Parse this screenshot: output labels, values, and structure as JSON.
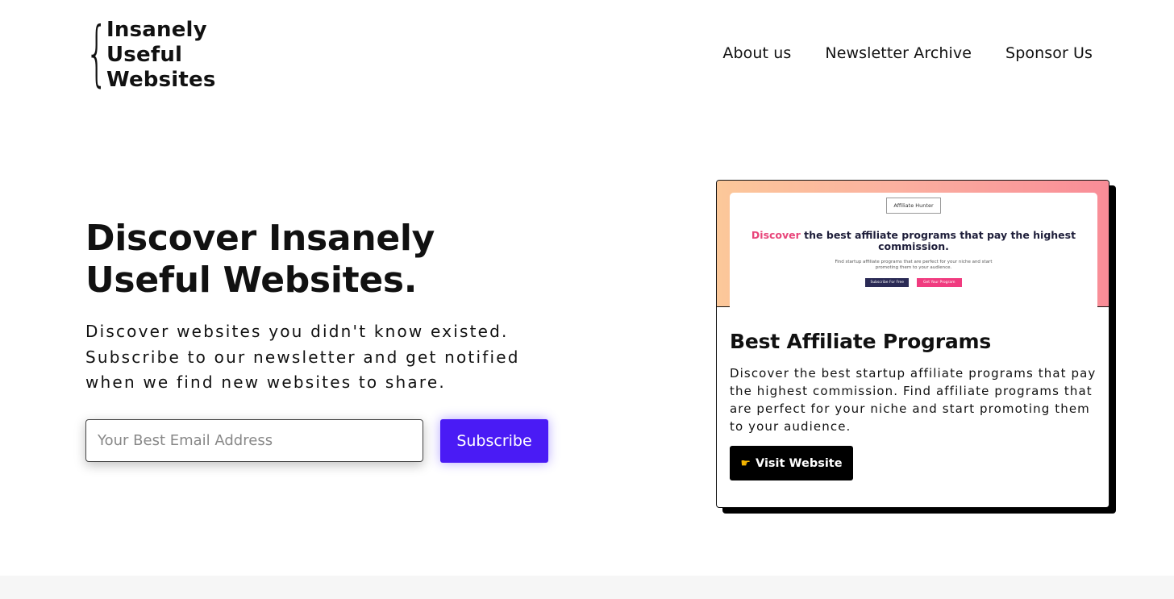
{
  "logo": {
    "brace": "{",
    "line1": "Insanely",
    "line2": "Useful",
    "line3": "Websites"
  },
  "nav": {
    "about": "About us",
    "archive": "Newsletter Archive",
    "sponsor": "Sponsor Us"
  },
  "hero": {
    "title": "Discover Insanely Useful Websites.",
    "subtitle": "Discover websites you didn't know existed. Subscribe to our newsletter and get notified when we find new websites to share."
  },
  "signup": {
    "email_placeholder": "Your Best Email Address",
    "subscribe_label": "Subscribe",
    "accent_color": "#4a1bf5"
  },
  "featured": {
    "preview": {
      "brand": "Affiliate Hunter",
      "headline_highlight": "Discover",
      "headline_rest": " the best affiliate programs that pay the highest commission.",
      "description": "Find startup affiliate programs that are perfect for your niche and start promoting them to your audience.",
      "btn_primary": "Subscribe For Free",
      "btn_secondary": "Get Your Program"
    },
    "title": "Best Affiliate Programs",
    "description": "Discover the best startup affiliate programs that pay the highest commission. Find affiliate programs that are perfect for your niche and start promoting them to your audience.",
    "visit_icon": "pointing-hand-icon",
    "visit_label": "Visit Website"
  }
}
